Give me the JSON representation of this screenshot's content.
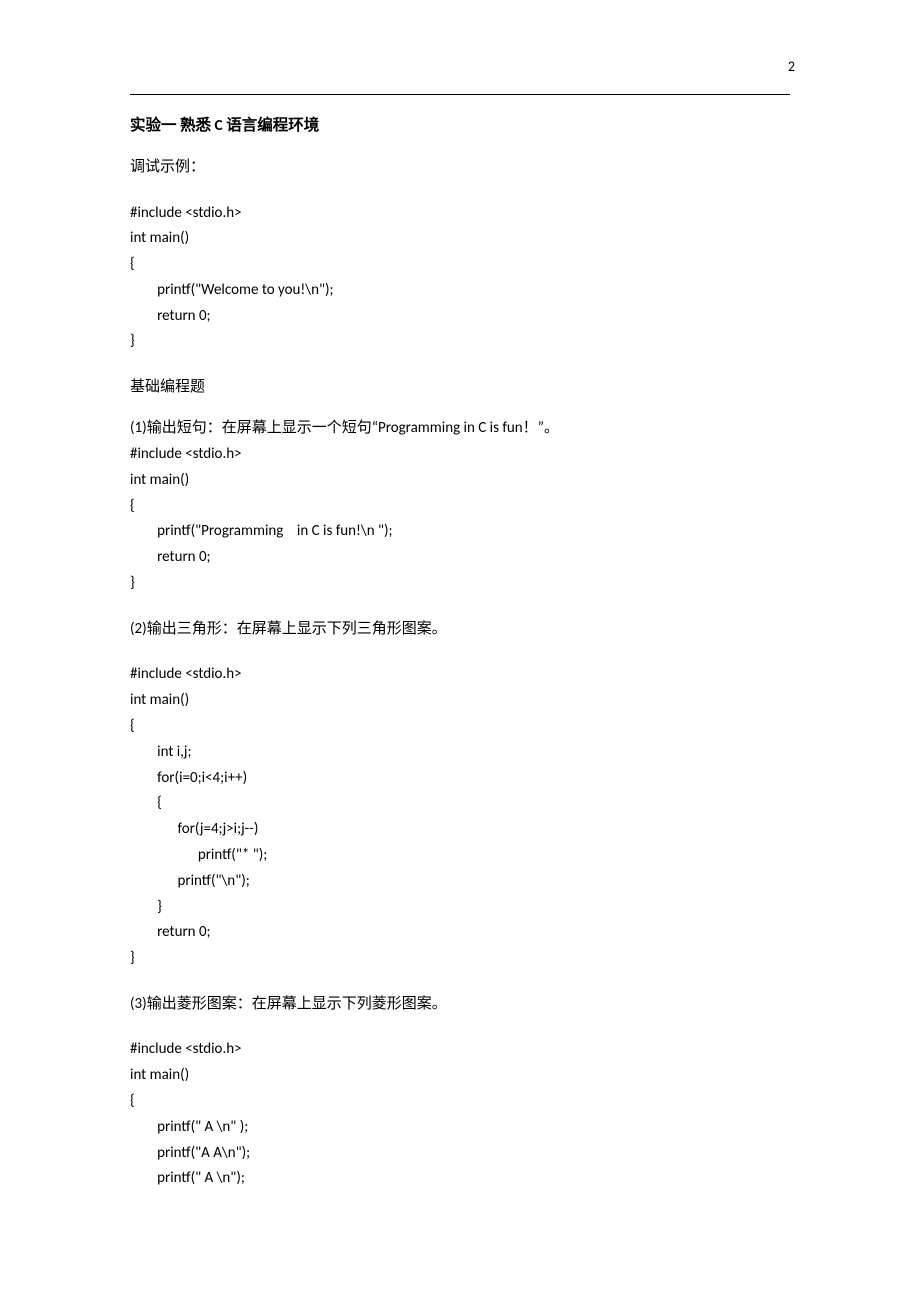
{
  "page_number": "2",
  "title": "实验一   熟悉 C 语言编程环境",
  "debug_label": "调试示例：",
  "code_example": "#include <stdio.h>\nint main()\n{\n        printf(\"Welcome to you!\\n\");\n        return 0;\n}",
  "basic_label": "基础编程题",
  "q1_desc": "(1)输出短句：在屏幕上显示一个短句“Programming in C is fun！”。",
  "q1_code": "#include <stdio.h>\nint main()\n{\n        printf(\"Programming    in C is fun!\\n \");\n        return 0;\n}",
  "q2_desc": "(2)输出三角形：在屏幕上显示下列三角形图案。",
  "q2_code": "#include <stdio.h>\nint main()\n{\n        int i,j;\n        for(i=0;i<4;i++)\n        {\n              for(j=4;j>i;j--)\n                    printf(\"* \");\n              printf(\"\\n\");\n        }\n        return 0;\n}",
  "q3_desc": "(3)输出菱形图案：在屏幕上显示下列菱形图案。",
  "q3_code": "#include <stdio.h>\nint main()\n{\n        printf(\" A \\n\" );\n        printf(\"A A\\n\");\n        printf(\" A \\n\");"
}
